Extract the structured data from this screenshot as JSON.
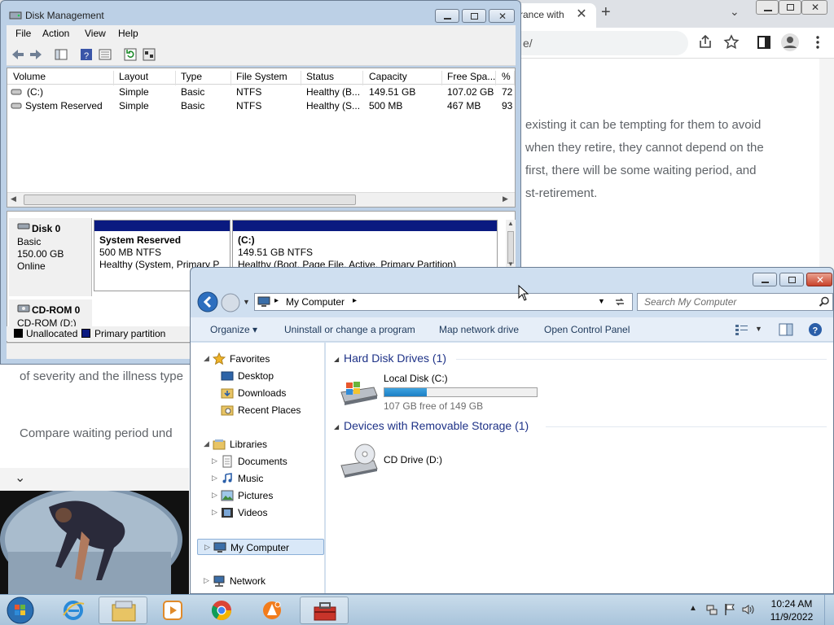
{
  "chrome": {
    "tab_title": "rance with",
    "tab_close": "✕",
    "newtab": "+",
    "tablist": "⌄",
    "url_fragment": "e/",
    "article_lines": [
      "existing it can be tempting for them to avoid",
      "when they retire, they cannot depend on the",
      "first, there will be some waiting period, and",
      "st-retirement."
    ],
    "article_left_1": "of severity and the illness type",
    "article_left_2": "Compare waiting period und",
    "video_chevron": "⌄"
  },
  "disk_mgmt": {
    "title": "Disk Management",
    "menu": [
      "File",
      "Action",
      "View",
      "Help"
    ],
    "columns": [
      "Volume",
      "Layout",
      "Type",
      "File System",
      "Status",
      "Capacity",
      "Free Spa...",
      "% F"
    ],
    "rows": [
      {
        "volume": "(C:)",
        "layout": "Simple",
        "type": "Basic",
        "fs": "NTFS",
        "status": "Healthy (B...",
        "capacity": "149.51 GB",
        "free": "107.02 GB",
        "pct": "72"
      },
      {
        "volume": "System Reserved",
        "layout": "Simple",
        "type": "Basic",
        "fs": "NTFS",
        "status": "Healthy (S...",
        "capacity": "500 MB",
        "free": "467 MB",
        "pct": "93"
      }
    ],
    "disk0": {
      "name": "Disk 0",
      "type": "Basic",
      "size": "150.00 GB",
      "state": "Online",
      "partitions": [
        {
          "name": "System Reserved",
          "size": "500 MB NTFS",
          "status": "Healthy (System, Primary P"
        },
        {
          "name": "(C:)",
          "size": "149.51 GB NTFS",
          "status": "Healthy (Boot, Page File, Active, Primary Partition)"
        }
      ]
    },
    "cdrom0": {
      "name": "CD-ROM 0",
      "drive": "CD-ROM (D:)"
    },
    "legend": {
      "unallocated": "Unallocated",
      "primary": "Primary partition"
    },
    "colors": {
      "partition_bar": "#0a1a80",
      "unallocated": "#000000"
    }
  },
  "explorer": {
    "breadcrumb": "My Computer",
    "search_placeholder": "Search My Computer",
    "commands": [
      "Organize",
      "Uninstall or change a program",
      "Map network drive",
      "Open Control Panel"
    ],
    "nav": {
      "favorites": "Favorites",
      "desktop": "Desktop",
      "downloads": "Downloads",
      "recent": "Recent Places",
      "libraries": "Libraries",
      "documents": "Documents",
      "music": "Music",
      "pictures": "Pictures",
      "videos": "Videos",
      "computer": "My Computer",
      "network": "Network"
    },
    "groups": {
      "hdd": "Hard Disk Drives (1)",
      "removable": "Devices with Removable Storage (1)"
    },
    "drives": {
      "c_name": "Local Disk (C:)",
      "c_free": "107 GB free of 149 GB",
      "c_used_fraction": 0.28,
      "d_name": "CD Drive (D:)"
    }
  },
  "taskbar": {
    "time": "10:24 AM",
    "date": "11/9/2022"
  }
}
